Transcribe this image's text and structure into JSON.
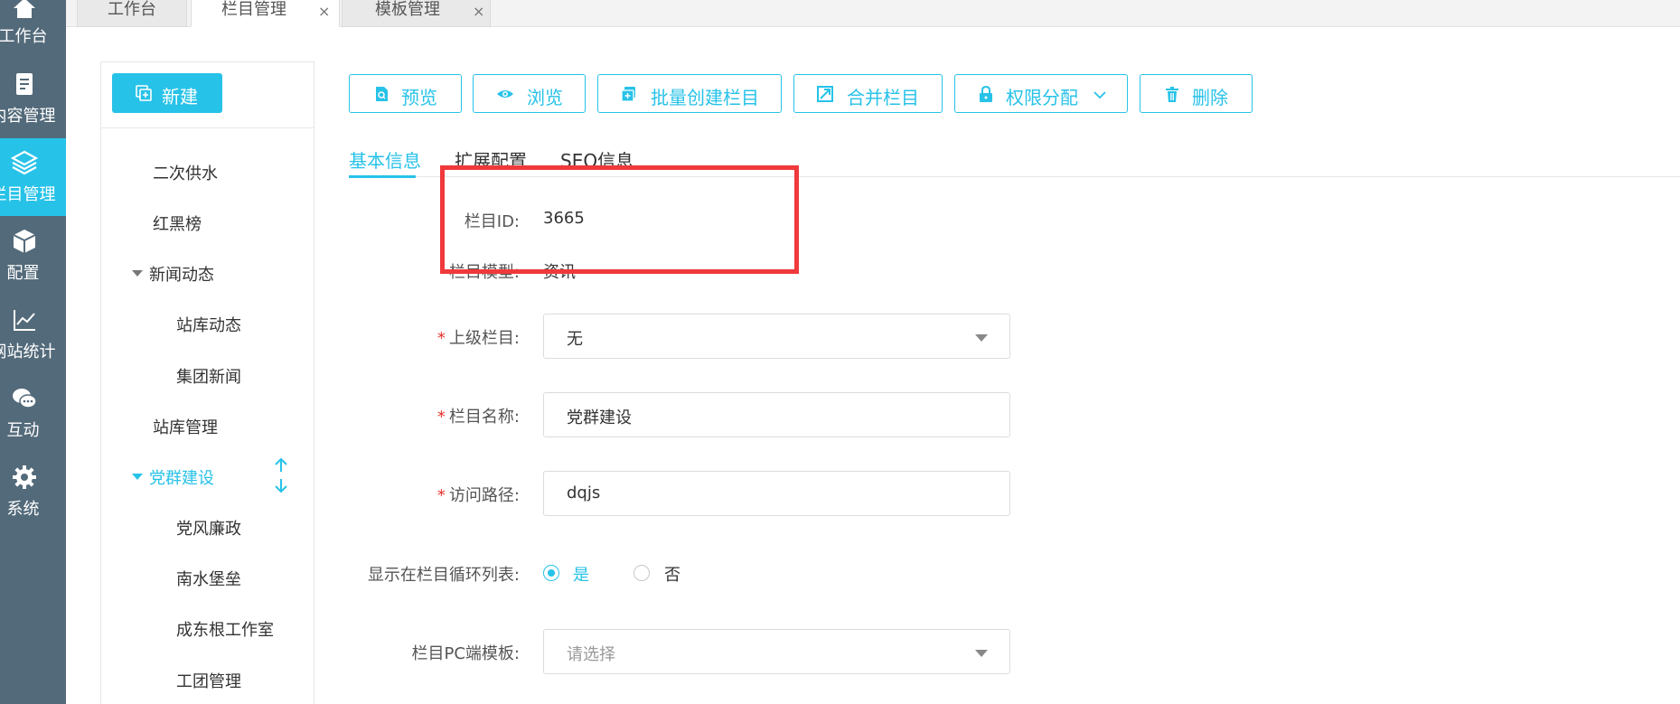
{
  "colors": {
    "accent": "#27c2e8",
    "rail": "#536a7a",
    "required": "#e5322d",
    "highlight": "#f0393b"
  },
  "rail": [
    {
      "label": "工作台",
      "icon": "home-icon",
      "active": false
    },
    {
      "label": "内容管理",
      "icon": "document-icon",
      "active": false
    },
    {
      "label": "栏目管理",
      "icon": "layers-icon",
      "active": true
    },
    {
      "label": "配置",
      "icon": "cube-icon",
      "active": false
    },
    {
      "label": "网站统计",
      "icon": "line-chart-icon",
      "active": false
    },
    {
      "label": "互动",
      "icon": "chat-icon",
      "active": false
    },
    {
      "label": "系统",
      "icon": "gear-icon",
      "active": false
    }
  ],
  "tabs": [
    {
      "label": "工作台",
      "closable": false,
      "active": false
    },
    {
      "label": "栏目管理",
      "closable": true,
      "active": true
    },
    {
      "label": "模板管理",
      "closable": true,
      "active": false
    }
  ],
  "tab_close_symbol": "×",
  "tree": {
    "new_label": "新建",
    "nodes": [
      {
        "label": "二次供水"
      },
      {
        "label": "红黑榜"
      },
      {
        "label": "新闻动态"
      },
      {
        "label": "站库动态"
      },
      {
        "label": "集团新闻"
      },
      {
        "label": "站库管理"
      },
      {
        "label": "党群建设"
      },
      {
        "label": "党风廉政"
      },
      {
        "label": "南水堡垒"
      },
      {
        "label": "成东根工作室"
      },
      {
        "label": "工团管理"
      }
    ]
  },
  "toolbar": {
    "preview": "预览",
    "browse": "浏览",
    "batch_create": "批量创建栏目",
    "merge": "合并栏目",
    "permission": "权限分配",
    "delete": "删除"
  },
  "subtabs": [
    {
      "label": "基本信息",
      "active": true
    },
    {
      "label": "扩展配置",
      "active": false
    },
    {
      "label": "SEO信息",
      "active": false
    }
  ],
  "form": {
    "required_mark": "*",
    "id_label": "栏目ID:",
    "id_value": "3665",
    "model_label": "栏目模型:",
    "model_value": "资讯",
    "parent_label": "上级栏目:",
    "parent_value": "无",
    "name_label": "栏目名称:",
    "name_value": "党群建设",
    "path_label": "访问路径:",
    "path_value": "dqjs",
    "show_label": "显示在栏目循环列表:",
    "show_yes": "是",
    "show_no": "否",
    "show_selected": "yes",
    "pc_template_label": "栏目PC端模板:",
    "pc_template_placeholder": "请选择"
  }
}
